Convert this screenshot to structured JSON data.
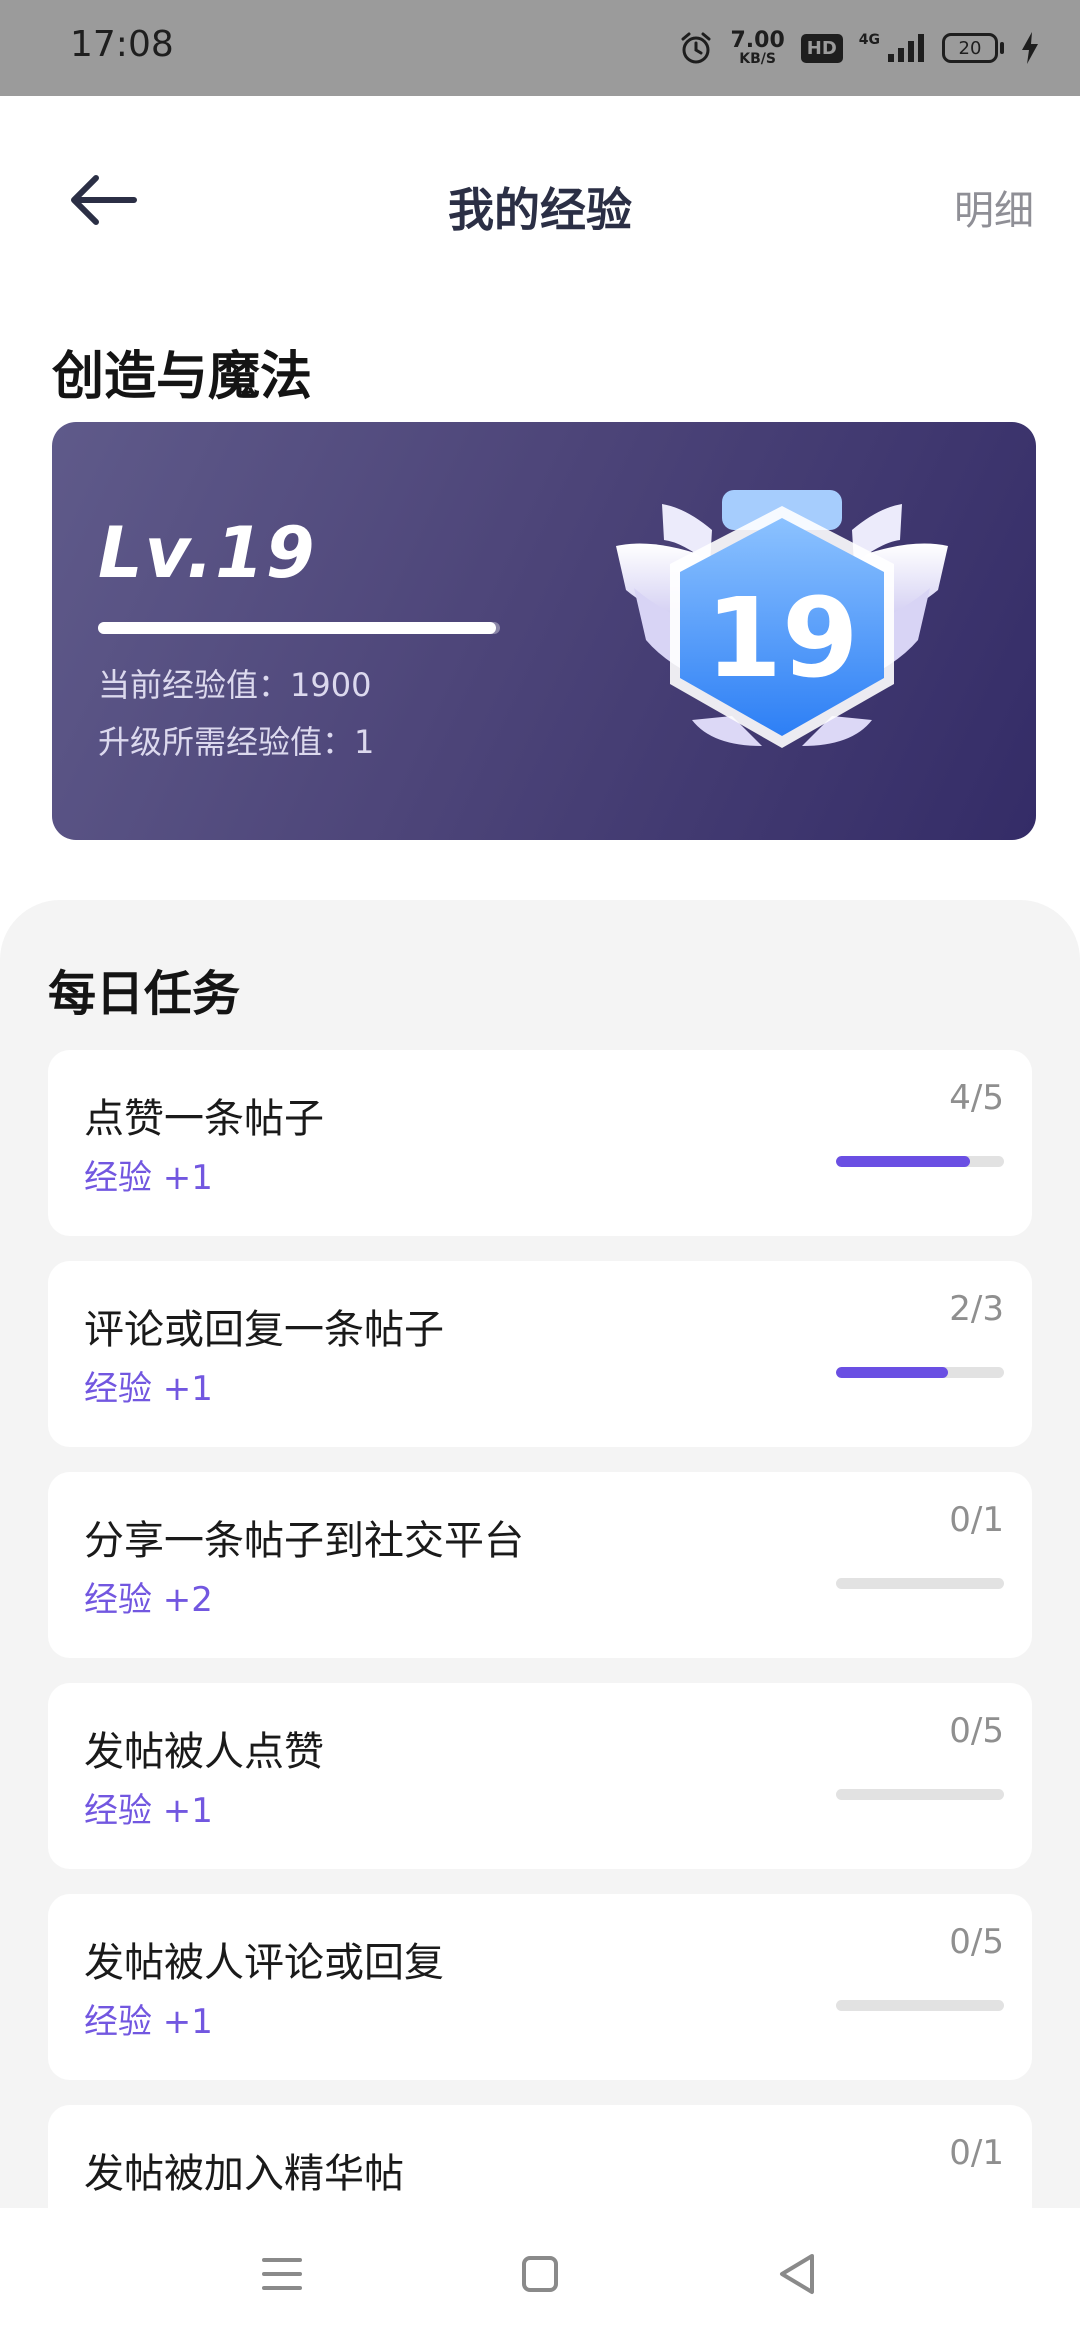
{
  "status_bar": {
    "time": "17:08",
    "net_speed_value": "7.00",
    "net_speed_unit": "KB/S",
    "hd_label": "HD",
    "network_label": "4G",
    "battery_level": "20",
    "icons": [
      "alarm-icon",
      "signal-icon",
      "battery-icon",
      "charging-icon"
    ]
  },
  "header": {
    "title": "我的经验",
    "detail_label": "明细",
    "back_icon": "arrow-left-icon"
  },
  "level_section": {
    "title": "创造与魔法",
    "level_label": "Lv.19",
    "level_progress": 0.99,
    "current_exp": "当前经验值：1900",
    "needed_exp": "升级所需经验值：1",
    "badge_number": "19"
  },
  "daily_tasks": {
    "title": "每日任务",
    "items": [
      {
        "name": "点赞一条帖子",
        "exp": "经验 +1",
        "count": "4/5",
        "progress": 0.8
      },
      {
        "name": "评论或回复一条帖子",
        "exp": "经验 +1",
        "count": "2/3",
        "progress": 0.667
      },
      {
        "name": "分享一条帖子到社交平台",
        "exp": "经验 +2",
        "count": "0/1",
        "progress": 0
      },
      {
        "name": "发帖被人点赞",
        "exp": "经验 +1",
        "count": "0/5",
        "progress": 0
      },
      {
        "name": "发帖被人评论或回复",
        "exp": "经验 +1",
        "count": "0/5",
        "progress": 0
      },
      {
        "name": "发帖被加入精华帖",
        "exp": "",
        "count": "0/1",
        "progress": 0
      }
    ]
  },
  "nav_bar": {
    "icons": [
      "menu-icon",
      "home-square-icon",
      "back-triangle-icon"
    ]
  },
  "colors": {
    "accent": "#6a4fe3",
    "exp_text": "#7257e0",
    "card_start": "#5f5a8a",
    "card_end": "#342c67"
  }
}
